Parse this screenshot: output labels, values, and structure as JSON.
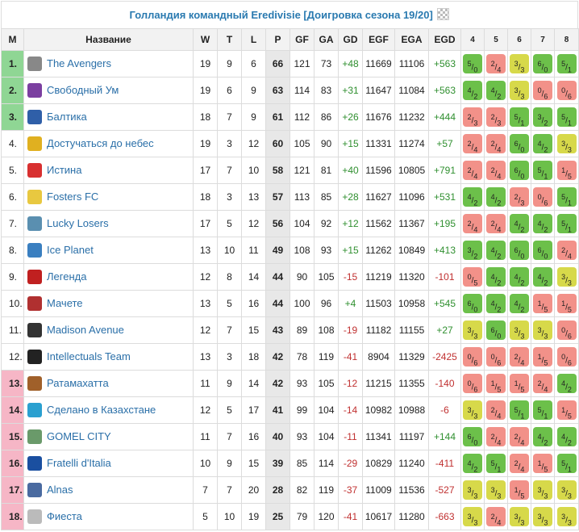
{
  "title": "Голландия командный Eredivisie [Доигровка сезона 19/20]",
  "columns": [
    "М",
    "Название",
    "W",
    "T",
    "L",
    "P",
    "GF",
    "GA",
    "GD",
    "EGF",
    "EGA",
    "EGD",
    "4",
    "5",
    "6",
    "7",
    "8"
  ],
  "colors": {
    "win": "#6cc04a",
    "loss": "#f29189",
    "draw": "#d7d94a",
    "top": "#8fd694",
    "bottom": "#f6b6c6",
    "link": "#2a6fa8"
  },
  "rows": [
    {
      "rank": "1.",
      "zone": "top",
      "team": "The Avengers",
      "logo": "avengers-logo",
      "logoColor": "#888",
      "w": "19",
      "t": "9",
      "l": "6",
      "p": "66",
      "gf": "121",
      "ga": "73",
      "gd": "+48",
      "egf": "11669",
      "ega": "11106",
      "egd": "+563",
      "results": [
        {
          "a": "5",
          "b": "0",
          "r": "W"
        },
        {
          "a": "2",
          "b": "4",
          "r": "L"
        },
        {
          "a": "3",
          "b": "3",
          "r": "D"
        },
        {
          "a": "6",
          "b": "0",
          "r": "W"
        },
        {
          "a": "5",
          "b": "1",
          "r": "W"
        }
      ]
    },
    {
      "rank": "2.",
      "zone": "top",
      "team": "Свободный Ум",
      "logo": "svobodny-um-logo",
      "logoColor": "#7b3fa0",
      "w": "19",
      "t": "6",
      "l": "9",
      "p": "63",
      "gf": "114",
      "ga": "83",
      "gd": "+31",
      "egf": "11647",
      "ega": "11084",
      "egd": "+563",
      "results": [
        {
          "a": "4",
          "b": "2",
          "r": "W"
        },
        {
          "a": "4",
          "b": "2",
          "r": "W"
        },
        {
          "a": "3",
          "b": "3",
          "r": "D"
        },
        {
          "a": "0",
          "b": "6",
          "r": "L"
        },
        {
          "a": "0",
          "b": "6",
          "r": "L"
        }
      ]
    },
    {
      "rank": "3.",
      "zone": "top",
      "team": "Балтика",
      "logo": "baltika-logo",
      "logoColor": "#2f5fa8",
      "w": "18",
      "t": "7",
      "l": "9",
      "p": "61",
      "gf": "112",
      "ga": "86",
      "gd": "+26",
      "egf": "11676",
      "ega": "11232",
      "egd": "+444",
      "results": [
        {
          "a": "2",
          "b": "3",
          "r": "L"
        },
        {
          "a": "2",
          "b": "3",
          "r": "L"
        },
        {
          "a": "5",
          "b": "1",
          "r": "W"
        },
        {
          "a": "3",
          "b": "2",
          "r": "W"
        },
        {
          "a": "5",
          "b": "1",
          "r": "W"
        }
      ]
    },
    {
      "rank": "4.",
      "zone": "",
      "team": "Достучаться до небес",
      "logo": "dostuchatsya-logo",
      "logoColor": "#e0b020",
      "w": "19",
      "t": "3",
      "l": "12",
      "p": "60",
      "gf": "105",
      "ga": "90",
      "gd": "+15",
      "egf": "11331",
      "ega": "11274",
      "egd": "+57",
      "results": [
        {
          "a": "2",
          "b": "4",
          "r": "L"
        },
        {
          "a": "2",
          "b": "4",
          "r": "L"
        },
        {
          "a": "6",
          "b": "0",
          "r": "W"
        },
        {
          "a": "4",
          "b": "2",
          "r": "W"
        },
        {
          "a": "3",
          "b": "3",
          "r": "D"
        }
      ]
    },
    {
      "rank": "5.",
      "zone": "",
      "team": "Истина",
      "logo": "istina-logo",
      "logoColor": "#d83030",
      "w": "17",
      "t": "7",
      "l": "10",
      "p": "58",
      "gf": "121",
      "ga": "81",
      "gd": "+40",
      "egf": "11596",
      "ega": "10805",
      "egd": "+791",
      "results": [
        {
          "a": "2",
          "b": "4",
          "r": "L"
        },
        {
          "a": "2",
          "b": "4",
          "r": "L"
        },
        {
          "a": "6",
          "b": "0",
          "r": "W"
        },
        {
          "a": "5",
          "b": "1",
          "r": "W"
        },
        {
          "a": "1",
          "b": "5",
          "r": "L"
        }
      ]
    },
    {
      "rank": "6.",
      "zone": "",
      "team": "Fosters FC",
      "logo": "fosters-logo",
      "logoColor": "#e8c840",
      "w": "18",
      "t": "3",
      "l": "13",
      "p": "57",
      "gf": "113",
      "ga": "85",
      "gd": "+28",
      "egf": "11627",
      "ega": "11096",
      "egd": "+531",
      "results": [
        {
          "a": "4",
          "b": "2",
          "r": "W"
        },
        {
          "a": "4",
          "b": "2",
          "r": "W"
        },
        {
          "a": "2",
          "b": "3",
          "r": "L"
        },
        {
          "a": "0",
          "b": "6",
          "r": "L"
        },
        {
          "a": "5",
          "b": "1",
          "r": "W"
        }
      ]
    },
    {
      "rank": "7.",
      "zone": "",
      "team": "Lucky Losers",
      "logo": "lucky-losers-logo",
      "logoColor": "#5a8fb0",
      "w": "17",
      "t": "5",
      "l": "12",
      "p": "56",
      "gf": "104",
      "ga": "92",
      "gd": "+12",
      "egf": "11562",
      "ega": "11367",
      "egd": "+195",
      "results": [
        {
          "a": "2",
          "b": "4",
          "r": "L"
        },
        {
          "a": "2",
          "b": "4",
          "r": "L"
        },
        {
          "a": "4",
          "b": "2",
          "r": "W"
        },
        {
          "a": "4",
          "b": "2",
          "r": "W"
        },
        {
          "a": "5",
          "b": "1",
          "r": "W"
        }
      ]
    },
    {
      "rank": "8.",
      "zone": "",
      "team": "Ice Planet",
      "logo": "ice-planet-logo",
      "logoColor": "#3a7fc0",
      "w": "13",
      "t": "10",
      "l": "11",
      "p": "49",
      "gf": "108",
      "ga": "93",
      "gd": "+15",
      "egf": "11262",
      "ega": "10849",
      "egd": "+413",
      "results": [
        {
          "a": "3",
          "b": "2",
          "r": "W"
        },
        {
          "a": "4",
          "b": "2",
          "r": "W"
        },
        {
          "a": "6",
          "b": "0",
          "r": "W"
        },
        {
          "a": "6",
          "b": "0",
          "r": "W"
        },
        {
          "a": "2",
          "b": "4",
          "r": "L"
        }
      ]
    },
    {
      "rank": "9.",
      "zone": "",
      "team": "Легенда",
      "logo": "legenda-logo",
      "logoColor": "#c02020",
      "w": "12",
      "t": "8",
      "l": "14",
      "p": "44",
      "gf": "90",
      "ga": "105",
      "gd": "-15",
      "egf": "11219",
      "ega": "11320",
      "egd": "-101",
      "results": [
        {
          "a": "0",
          "b": "5",
          "r": "L"
        },
        {
          "a": "4",
          "b": "2",
          "r": "W"
        },
        {
          "a": "4",
          "b": "2",
          "r": "W"
        },
        {
          "a": "4",
          "b": "2",
          "r": "W"
        },
        {
          "a": "3",
          "b": "3",
          "r": "D"
        }
      ]
    },
    {
      "rank": "10.",
      "zone": "",
      "team": "Мачете",
      "logo": "machete-logo",
      "logoColor": "#b03030",
      "w": "13",
      "t": "5",
      "l": "16",
      "p": "44",
      "gf": "100",
      "ga": "96",
      "gd": "+4",
      "egf": "11503",
      "ega": "10958",
      "egd": "+545",
      "results": [
        {
          "a": "6",
          "b": "0",
          "r": "W"
        },
        {
          "a": "4",
          "b": "2",
          "r": "W"
        },
        {
          "a": "4",
          "b": "2",
          "r": "W"
        },
        {
          "a": "1",
          "b": "5",
          "r": "L"
        },
        {
          "a": "1",
          "b": "5",
          "r": "L"
        }
      ]
    },
    {
      "rank": "11.",
      "zone": "",
      "team": "Madison Avenue",
      "logo": "madison-logo",
      "logoColor": "#333",
      "w": "12",
      "t": "7",
      "l": "15",
      "p": "43",
      "gf": "89",
      "ga": "108",
      "gd": "-19",
      "egf": "11182",
      "ega": "11155",
      "egd": "+27",
      "results": [
        {
          "a": "3",
          "b": "3",
          "r": "D"
        },
        {
          "a": "6",
          "b": "0",
          "r": "W"
        },
        {
          "a": "3",
          "b": "3",
          "r": "D"
        },
        {
          "a": "3",
          "b": "3",
          "r": "D"
        },
        {
          "a": "0",
          "b": "6",
          "r": "L"
        }
      ]
    },
    {
      "rank": "12.",
      "zone": "",
      "team": "Intellectuals Team",
      "logo": "intellectuals-logo",
      "logoColor": "#222",
      "w": "13",
      "t": "3",
      "l": "18",
      "p": "42",
      "gf": "78",
      "ga": "119",
      "gd": "-41",
      "egf": "8904",
      "ega": "11329",
      "egd": "-2425",
      "results": [
        {
          "a": "0",
          "b": "6",
          "r": "L"
        },
        {
          "a": "0",
          "b": "6",
          "r": "L"
        },
        {
          "a": "2",
          "b": "4",
          "r": "L"
        },
        {
          "a": "1",
          "b": "5",
          "r": "L"
        },
        {
          "a": "0",
          "b": "6",
          "r": "L"
        }
      ]
    },
    {
      "rank": "13.",
      "zone": "bottom",
      "team": "Ратамахатта",
      "logo": "ratamahatta-logo",
      "logoColor": "#a0602a",
      "w": "11",
      "t": "9",
      "l": "14",
      "p": "42",
      "gf": "93",
      "ga": "105",
      "gd": "-12",
      "egf": "11215",
      "ega": "11355",
      "egd": "-140",
      "results": [
        {
          "a": "0",
          "b": "6",
          "r": "L"
        },
        {
          "a": "1",
          "b": "5",
          "r": "L"
        },
        {
          "a": "1",
          "b": "5",
          "r": "L"
        },
        {
          "a": "2",
          "b": "4",
          "r": "L"
        },
        {
          "a": "4",
          "b": "2",
          "r": "W"
        }
      ]
    },
    {
      "rank": "14.",
      "zone": "bottom",
      "team": "Сделано в Казахстане",
      "logo": "kazakhstan-logo",
      "logoColor": "#2aa0d0",
      "w": "12",
      "t": "5",
      "l": "17",
      "p": "41",
      "gf": "99",
      "ga": "104",
      "gd": "-14",
      "egf": "10982",
      "ega": "10988",
      "egd": "-6",
      "results": [
        {
          "a": "3",
          "b": "3",
          "r": "D"
        },
        {
          "a": "2",
          "b": "4",
          "r": "L"
        },
        {
          "a": "5",
          "b": "1",
          "r": "W"
        },
        {
          "a": "5",
          "b": "1",
          "r": "W"
        },
        {
          "a": "1",
          "b": "5",
          "r": "L"
        }
      ]
    },
    {
      "rank": "15.",
      "zone": "bottom",
      "team": "GOMEL CITY",
      "logo": "gomel-city-logo",
      "logoColor": "#6a9a6a",
      "w": "11",
      "t": "7",
      "l": "16",
      "p": "40",
      "gf": "93",
      "ga": "104",
      "gd": "-11",
      "egf": "11341",
      "ega": "11197",
      "egd": "+144",
      "results": [
        {
          "a": "6",
          "b": "0",
          "r": "W"
        },
        {
          "a": "2",
          "b": "4",
          "r": "L"
        },
        {
          "a": "2",
          "b": "4",
          "r": "L"
        },
        {
          "a": "4",
          "b": "2",
          "r": "W"
        },
        {
          "a": "4",
          "b": "2",
          "r": "W"
        }
      ]
    },
    {
      "rank": "16.",
      "zone": "bottom",
      "team": "Fratelli d'Italia",
      "logo": "fratelli-logo",
      "logoColor": "#1a4fa0",
      "w": "10",
      "t": "9",
      "l": "15",
      "p": "39",
      "gf": "85",
      "ga": "114",
      "gd": "-29",
      "egf": "10829",
      "ega": "11240",
      "egd": "-411",
      "results": [
        {
          "a": "4",
          "b": "2",
          "r": "W"
        },
        {
          "a": "5",
          "b": "1",
          "r": "W"
        },
        {
          "a": "2",
          "b": "4",
          "r": "L"
        },
        {
          "a": "1",
          "b": "5",
          "r": "L"
        },
        {
          "a": "5",
          "b": "1",
          "r": "W"
        }
      ]
    },
    {
      "rank": "17.",
      "zone": "bottom",
      "team": "Alnas",
      "logo": "alnas-logo",
      "logoColor": "#4a6aa0",
      "w": "7",
      "t": "7",
      "l": "20",
      "p": "28",
      "gf": "82",
      "ga": "119",
      "gd": "-37",
      "egf": "11009",
      "ega": "11536",
      "egd": "-527",
      "results": [
        {
          "a": "3",
          "b": "3",
          "r": "D"
        },
        {
          "a": "3",
          "b": "3",
          "r": "D"
        },
        {
          "a": "1",
          "b": "5",
          "r": "L"
        },
        {
          "a": "3",
          "b": "3",
          "r": "D"
        },
        {
          "a": "3",
          "b": "3",
          "r": "D"
        }
      ]
    },
    {
      "rank": "18.",
      "zone": "bottom",
      "team": "Фиеста",
      "logo": "fiesta-logo",
      "logoColor": "#bbbbbb",
      "w": "5",
      "t": "10",
      "l": "19",
      "p": "25",
      "gf": "79",
      "ga": "120",
      "gd": "-41",
      "egf": "10617",
      "ega": "11280",
      "egd": "-663",
      "results": [
        {
          "a": "3",
          "b": "3",
          "r": "D"
        },
        {
          "a": "2",
          "b": "4",
          "r": "L"
        },
        {
          "a": "3",
          "b": "3",
          "r": "D"
        },
        {
          "a": "3",
          "b": "3",
          "r": "D"
        },
        {
          "a": "3",
          "b": "3",
          "r": "D"
        }
      ]
    }
  ]
}
